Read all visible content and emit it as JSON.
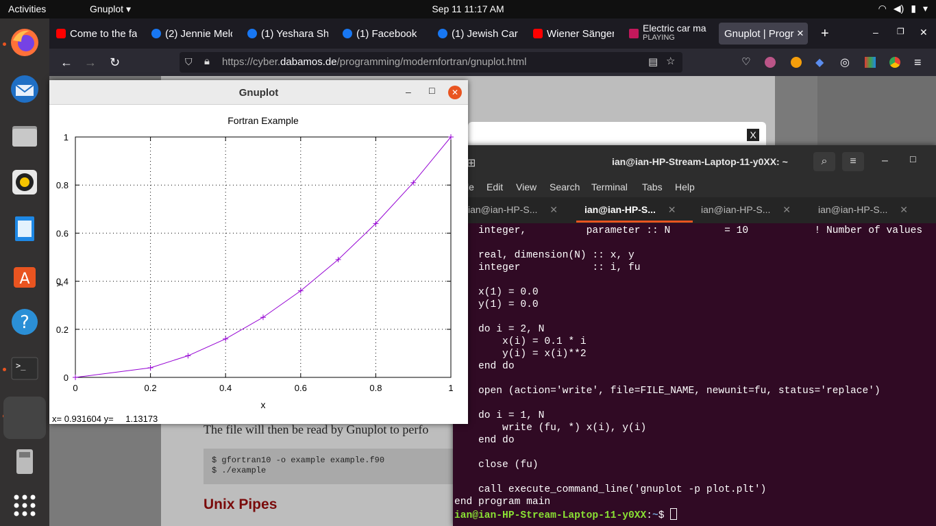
{
  "topbar": {
    "activities": "Activities",
    "app_menu": "Gnuplot",
    "clock": "Sep 11  11:17 AM"
  },
  "browser": {
    "tabs": [
      {
        "label": "Come to the fa",
        "icon": "youtube-icon",
        "color": "#ff0000"
      },
      {
        "label": "(2) Jennie Melo",
        "icon": "facebook-icon",
        "color": "#1877f2"
      },
      {
        "label": "(1) Yeshara Sh",
        "icon": "facebook-icon",
        "color": "#1877f2"
      },
      {
        "label": "(1) Facebook",
        "icon": "facebook-icon",
        "color": "#1877f2"
      },
      {
        "label": "(1) Jewish Car",
        "icon": "facebook-icon",
        "color": "#1877f2"
      },
      {
        "label": "Wiener Sänger",
        "icon": "youtube-icon",
        "color": "#ff0000"
      },
      {
        "label": "Electric car ma",
        "sub": "PLAYING",
        "icon": "media-icon",
        "color": "#c2185b"
      },
      {
        "label": "Gnuplot | Progr",
        "icon": "",
        "color": ""
      }
    ],
    "url_prefix": "https://cyber.",
    "url_domain": "dabamos.de",
    "url_path": "/programming/modernfortran/gnuplot.html"
  },
  "webpage": {
    "paragraph": "The file will then be read by Gnuplot to perfo",
    "code": [
      "$ gfortran10 -o example example.f90",
      "$ ./example"
    ],
    "heading": "Unix Pipes",
    "modal_close": "X"
  },
  "gnuplot": {
    "window_title": "Gnuplot",
    "status_x_label": "x=",
    "status_x": "0.931604",
    "status_y_label": "y=",
    "status_y": "1.13173"
  },
  "chart_data": {
    "type": "line",
    "title": "Fortran Example",
    "xlabel": "x",
    "ylabel": "y",
    "xlim": [
      0,
      1
    ],
    "ylim": [
      0,
      1
    ],
    "xticks": [
      "0",
      "0.2",
      "0.4",
      "0.6",
      "0.8",
      "1"
    ],
    "yticks": [
      "0",
      "0.2",
      "0.4",
      "0.6",
      "0.8",
      "1"
    ],
    "grid": true,
    "series": [
      {
        "color": "#9400d3",
        "x": [
          0.0,
          0.2,
          0.3,
          0.4,
          0.5,
          0.6,
          0.7,
          0.8,
          0.9,
          1.0
        ],
        "y": [
          0.0,
          0.04,
          0.09,
          0.16,
          0.25,
          0.36,
          0.49,
          0.64,
          0.81,
          1.0
        ]
      }
    ]
  },
  "terminal": {
    "title": "ian@ian-HP-Stream-Laptop-11-y0XX: ~",
    "menu": [
      "le",
      "Edit",
      "View",
      "Search",
      "Terminal",
      "Tabs",
      "Help"
    ],
    "tabs": [
      "ian@ian-HP-S...",
      "ian@ian-HP-S...",
      "ian@ian-HP-S...",
      "ian@ian-HP-S..."
    ],
    "code": "    integer,          parameter :: N         = 10           ! Number of values\n\n    real, dimension(N) :: x, y\n    integer            :: i, fu\n\n    x(1) = 0.0\n    y(1) = 0.0\n\n    do i = 2, N\n        x(i) = 0.1 * i\n        y(i) = x(i)**2\n    end do\n\n    open (action='write', file=FILE_NAME, newunit=fu, status='replace')\n\n    do i = 1, N\n        write (fu, *) x(i), y(i)\n    end do\n\n    close (fu)\n\n    call execute_command_line('gnuplot -p plot.plt')\nend program main",
    "prompt_user": "ian@ian-HP-Stream-Laptop-11-y0XX",
    "prompt_sep": ":",
    "prompt_path": "~",
    "prompt_sign": "$ "
  }
}
